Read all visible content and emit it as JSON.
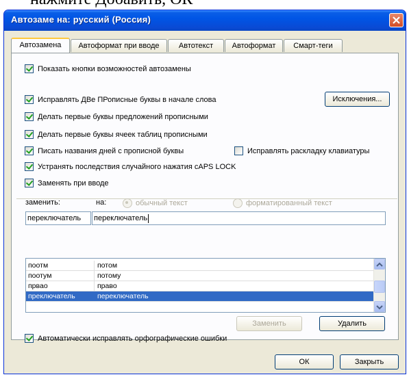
{
  "background_text": "нажмите Добавить, ОК",
  "dialog": {
    "title": "Автозаме на: русский (Россия)"
  },
  "tabs": [
    "Автозамена",
    "Автоформат при вводе",
    "Автотекст",
    "Автоформат",
    "Смарт-теги"
  ],
  "options": {
    "show_buttons": "Показать кнопки возможностей автозамены",
    "two_caps": "Исправлять ДВе ПРописные буквы в начале слова",
    "exceptions_button": "Исключения...",
    "first_letter_sentences": "Делать первые буквы предложений прописными",
    "first_letter_cells": "Делать первые буквы ячеек таблиц прописными",
    "day_names": "Писать названия дней с прописной буквы",
    "keyboard_layout": "Исправлять раскладку клавиатуры",
    "caps_lock": "Устранять последствия случайного нажатия cAPS LOCK",
    "replace_as_you_type": "Заменять при вводе"
  },
  "replace_section": {
    "replace_label": "заменить:",
    "with_label": "на:",
    "plain_text": "обычный текст",
    "formatted_text": "форматированный текст",
    "replace_value": "переключатель",
    "with_value": "переключатель"
  },
  "list": [
    {
      "from": "поотм",
      "to": "потом"
    },
    {
      "from": "поотум",
      "to": "потому"
    },
    {
      "from": "првао",
      "to": "право"
    },
    {
      "from": "преключатель",
      "to": "переключатель"
    }
  ],
  "buttons": {
    "replace": "Заменить",
    "delete": "Удалить",
    "ok": "ОК",
    "close": "Закрыть"
  },
  "spelling_option": "Автоматически исправлять орфографические ошибки"
}
